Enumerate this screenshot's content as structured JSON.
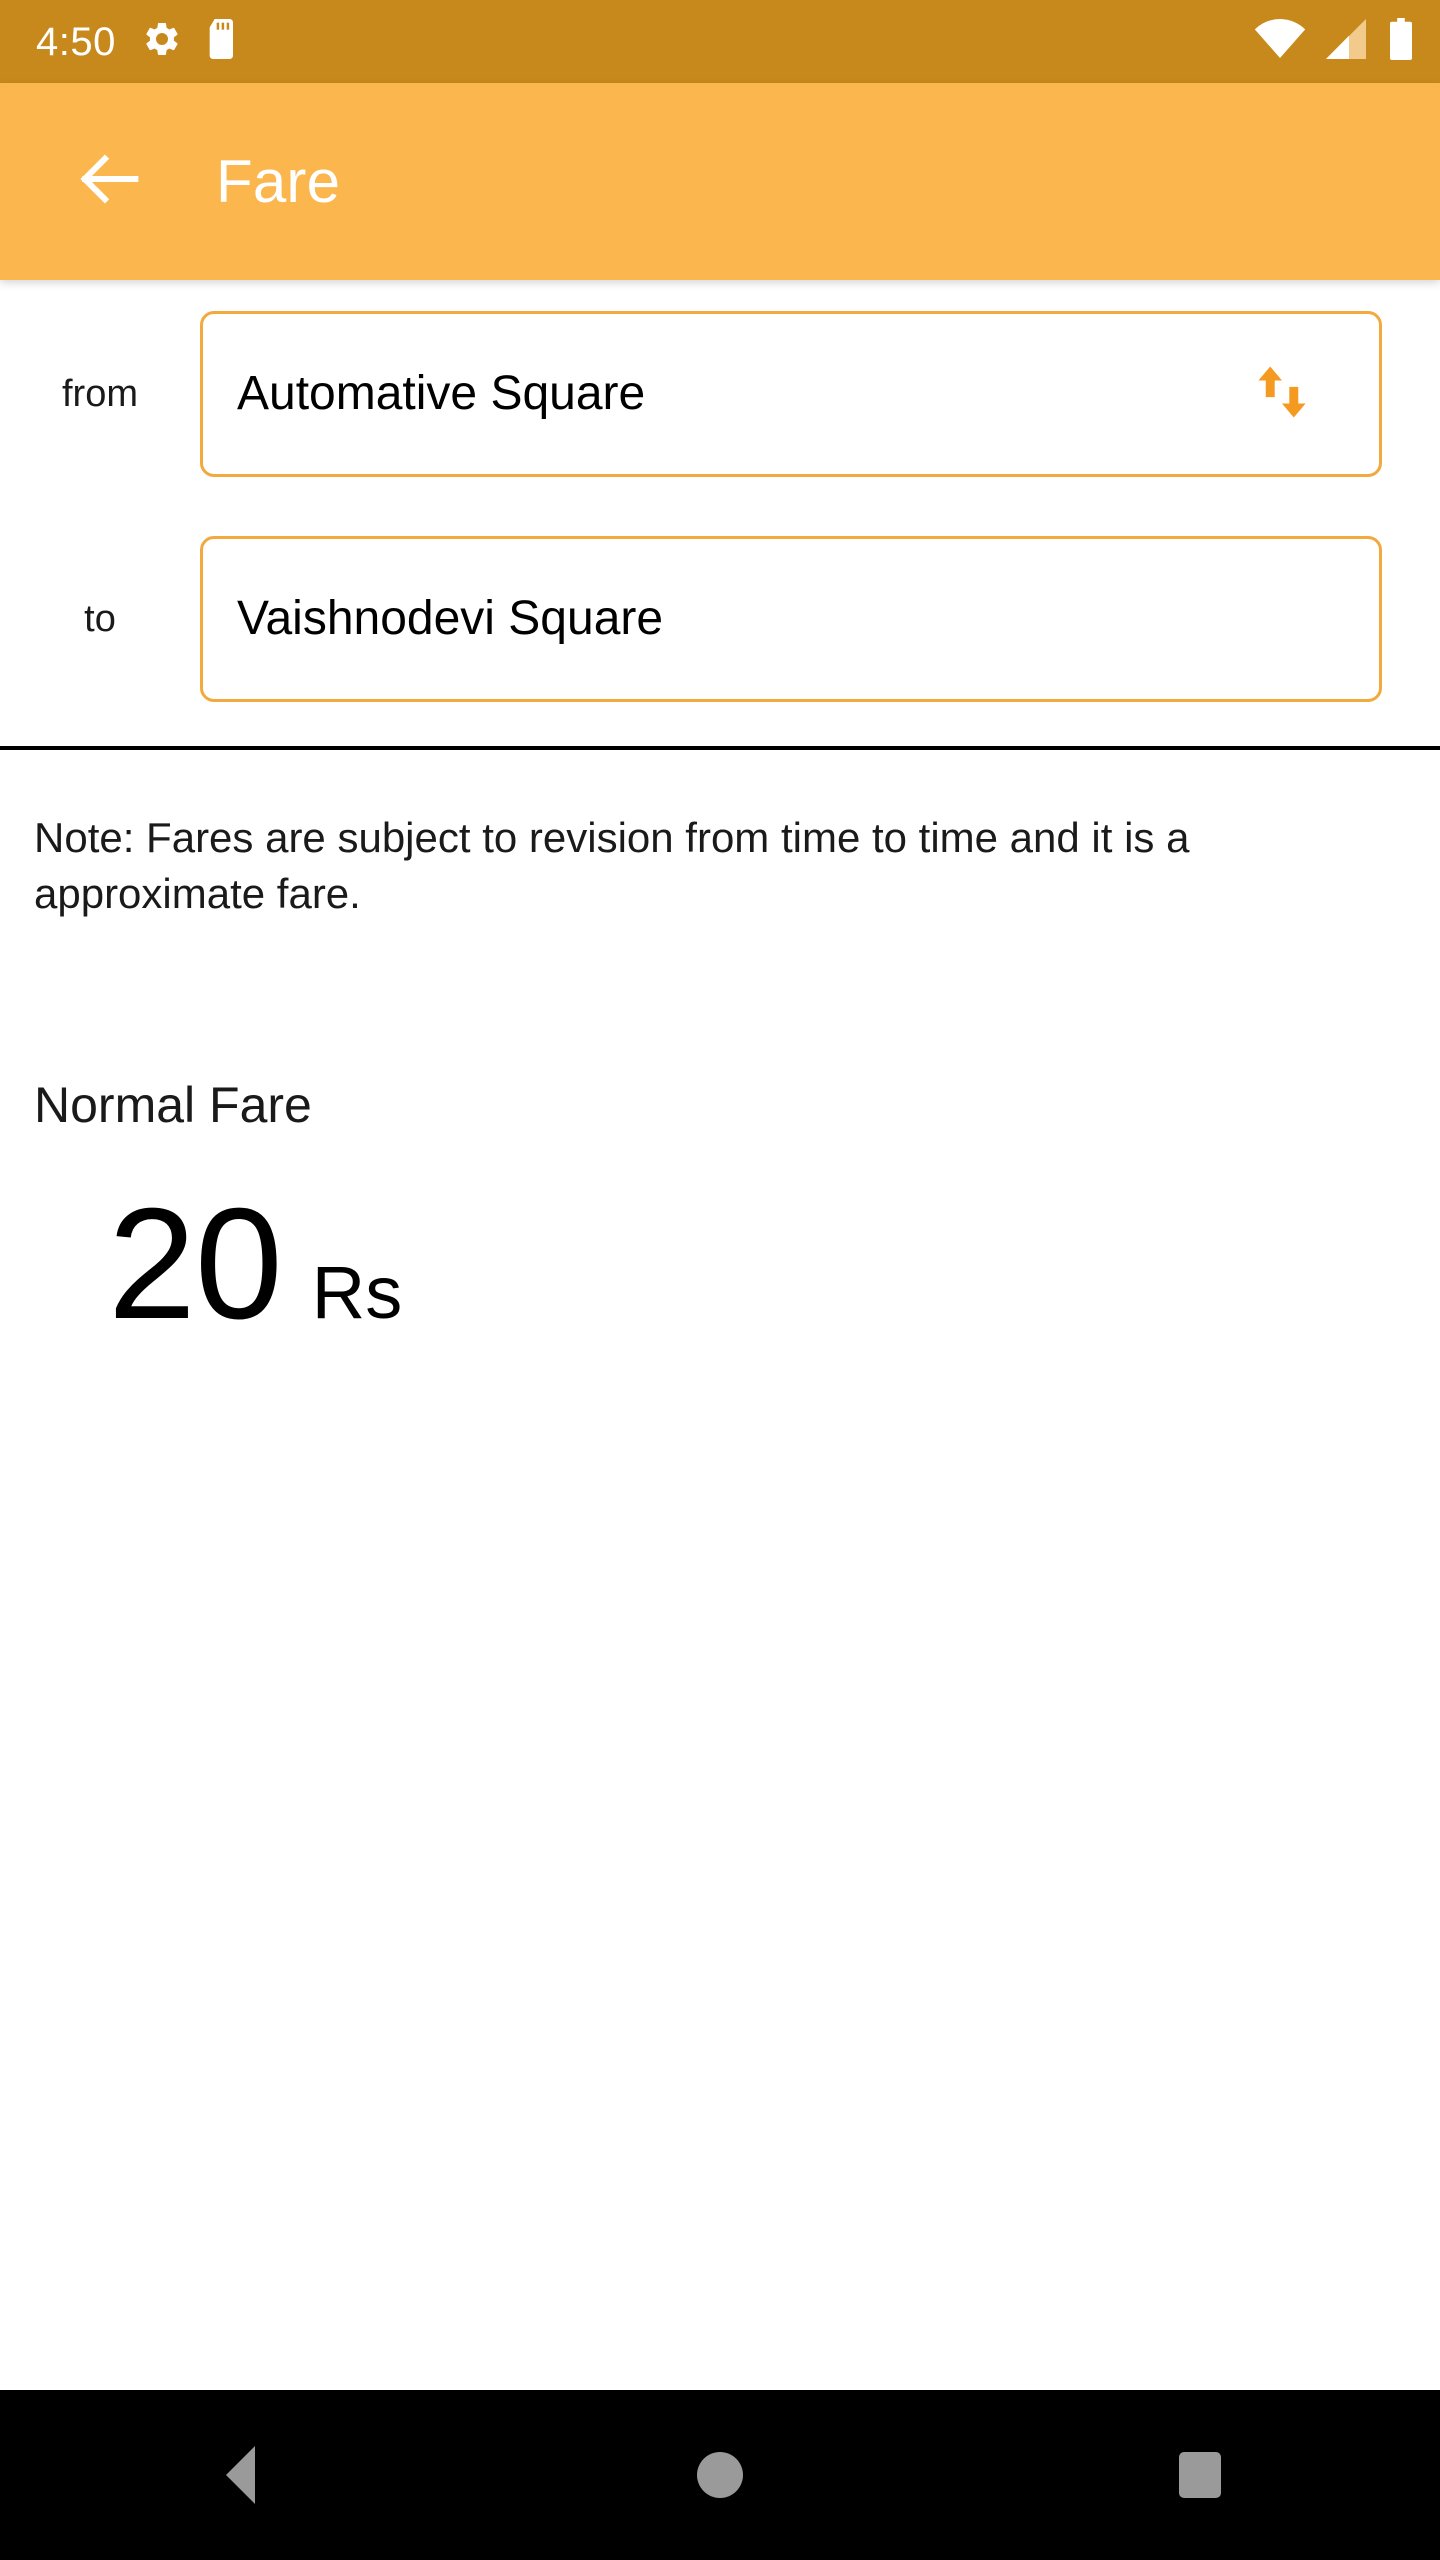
{
  "status_bar": {
    "time": "4:50",
    "background_color": "#C8891C",
    "icons_left": [
      "gear-icon",
      "sd-card-icon"
    ],
    "icons_right": [
      "wifi-icon",
      "cellular-signal-icon",
      "battery-icon"
    ]
  },
  "app_bar": {
    "title": "Fare",
    "back_icon": "back-arrow-icon",
    "background_color": "#FCB64E",
    "title_color": "#FFFFFF"
  },
  "form": {
    "from": {
      "label": "from",
      "value": "Automative Square",
      "placeholder": "from",
      "swap_icon": "swap-vertical-icon"
    },
    "to": {
      "label": "to",
      "value": "Vaishnodevi Square",
      "placeholder": "to"
    },
    "border_color": "#F2A93D",
    "accent_color": "#F59A20"
  },
  "note": {
    "text": "Note: Fares are subject to revision from time to time and it is a approximate fare."
  },
  "fare": {
    "heading": "Normal Fare",
    "amount": "20",
    "currency": "Rs"
  },
  "nav_bar": {
    "back_label": "back-triangle",
    "home_label": "home-circle",
    "recents_label": "recents-square",
    "background_color": "#000000",
    "icon_color": "#9A9A9A"
  }
}
